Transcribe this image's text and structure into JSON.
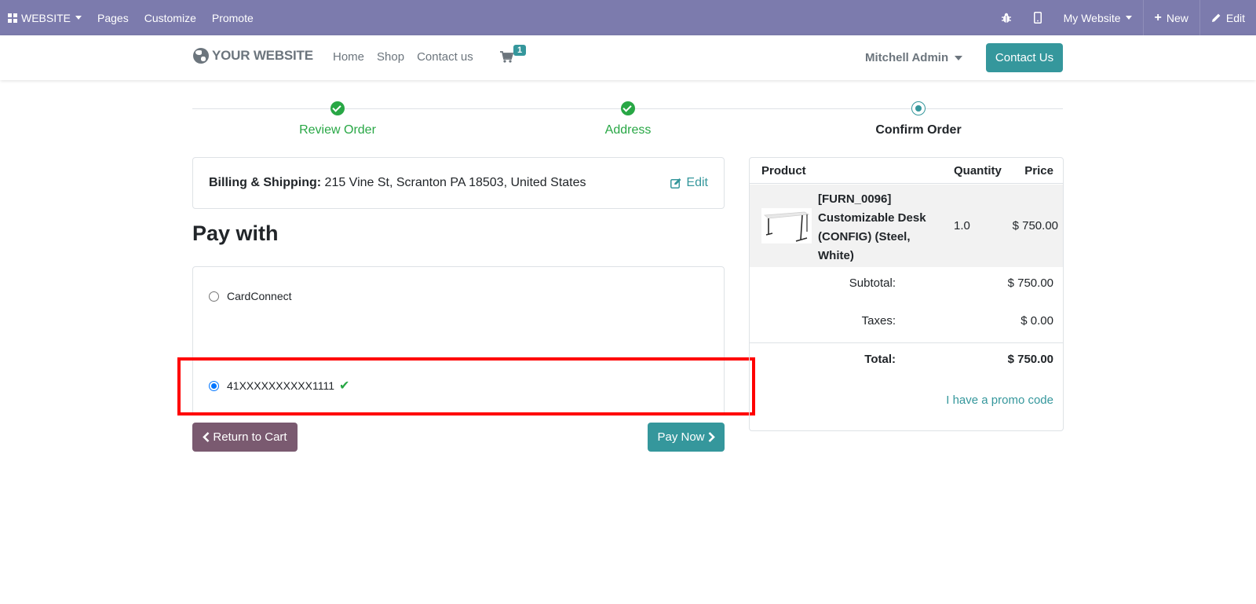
{
  "adminbar": {
    "apps_label": "WEBSITE",
    "menu": [
      "Pages",
      "Customize",
      "Promote"
    ],
    "website_selector": "My Website",
    "new_label": "New",
    "edit_label": "Edit"
  },
  "header": {
    "logo_text": "YOUR WEBSITE",
    "nav": [
      "Home",
      "Shop",
      "Contact us"
    ],
    "cart_count": "1",
    "user_name": "Mitchell Admin",
    "contact_button": "Contact Us"
  },
  "wizard": {
    "steps": [
      {
        "label": "Review Order",
        "state": "done"
      },
      {
        "label": "Address",
        "state": "done"
      },
      {
        "label": "Confirm Order",
        "state": "current"
      }
    ]
  },
  "billing": {
    "label": "Billing & Shipping:",
    "address": " 215 Vine St, Scranton PA 18503, United States",
    "edit_label": "Edit"
  },
  "payment": {
    "heading": "Pay with",
    "options": [
      {
        "label": "CardConnect",
        "checked": false
      },
      {
        "label": "41XXXXXXXXXX1111",
        "checked": true
      }
    ],
    "return_button": "Return to Cart",
    "pay_button": "Pay Now"
  },
  "summary": {
    "headers": {
      "product": "Product",
      "quantity": "Quantity",
      "price": "Price"
    },
    "line": {
      "name": "[FURN_0096] Customizable Desk (CONFIG) (Steel, White)",
      "quantity": "1.0",
      "price": "$ 750.00"
    },
    "subtotal_label": "Subtotal:",
    "subtotal": "$ 750.00",
    "taxes_label": "Taxes:",
    "taxes": "$ 0.00",
    "total_label": "Total:",
    "total": "$ 750.00",
    "promo_link": "I have a promo code"
  },
  "colors": {
    "adminbar": "#7c7bad",
    "primary": "#35979c",
    "success": "#28a745",
    "secondary_button": "#7a5a70",
    "highlight": "#ff0000"
  }
}
